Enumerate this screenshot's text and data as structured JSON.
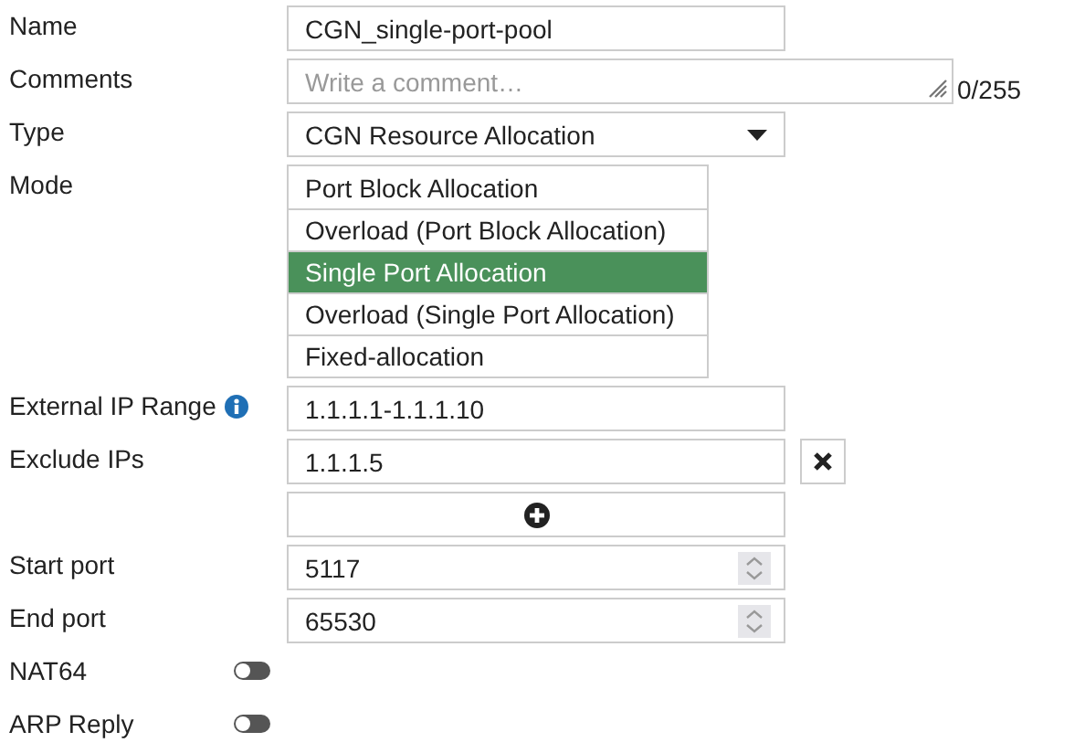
{
  "fields": [
    {
      "kind": "text",
      "label": "Name",
      "value": "CGN_single-port-pool"
    },
    {
      "kind": "textarea",
      "label": "Comments",
      "placeholder": "Write a comment…",
      "counter": "0/255"
    },
    {
      "kind": "select",
      "label": "Type",
      "value": "CGN Resource Allocation"
    },
    {
      "kind": "list",
      "label": "Mode",
      "options": [
        {
          "label": "Port Block Allocation",
          "selected": false
        },
        {
          "label": "Overload (Port Block Allocation)",
          "selected": false
        },
        {
          "label": "Single Port Allocation",
          "selected": true
        },
        {
          "label": "Overload (Single Port Allocation)",
          "selected": false
        },
        {
          "label": "Fixed-allocation",
          "selected": false
        }
      ]
    },
    {
      "kind": "text",
      "label": "External IP Range",
      "info": true,
      "value": "1.1.1.1-1.1.1.10"
    },
    {
      "kind": "multi",
      "label": "Exclude IPs",
      "values": [
        "1.1.1.5"
      ]
    },
    {
      "kind": "number",
      "label": "Start port",
      "value": "5117"
    },
    {
      "kind": "number",
      "label": "End port",
      "value": "65530"
    },
    {
      "kind": "toggle",
      "label": "NAT64",
      "on": false
    },
    {
      "kind": "toggle",
      "label": "ARP Reply",
      "on": false
    }
  ]
}
